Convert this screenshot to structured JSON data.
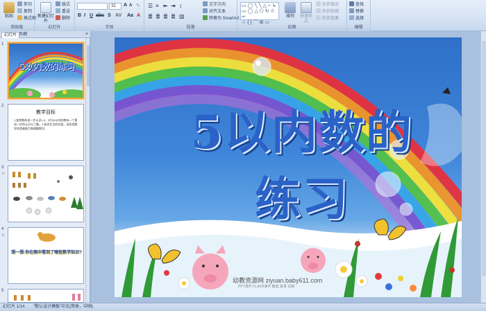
{
  "ribbon": {
    "groups": {
      "clipboard": "剪贴板",
      "slides": "幻灯片",
      "font": "字体",
      "paragraph": "段落",
      "drawing": "绘图",
      "editing": "编辑"
    },
    "paste": "粘贴",
    "cut": "剪切",
    "copy": "复制",
    "format_painter": "格式刷",
    "new_slide": "新建幻灯片",
    "layout": "版式",
    "reset": "重设",
    "delete": "删除",
    "font_size": "32",
    "text_direction": "文字方向",
    "align_text": "对齐文本",
    "smartart": "转换为 SmartArt",
    "arrange": "排列",
    "quick_styles": "快速样式",
    "shape_fill": "形状填充",
    "shape_outline": "形状轮廓",
    "shape_effects": "形状效果",
    "find": "查找",
    "replace": "替换",
    "select": "选择"
  },
  "pane": {
    "tab_slides": "幻灯片",
    "tab_outline": "大纲",
    "close": "×",
    "thumbs": [
      {
        "num": "1",
        "star": ""
      },
      {
        "num": "2",
        "star": ""
      },
      {
        "num": "3",
        "star": "☆"
      },
      {
        "num": "4",
        "star": "☆"
      },
      {
        "num": "5",
        "star": ""
      }
    ],
    "thumb1_title": "5以内数的练习",
    "thumb2_title": "教学目标",
    "thumb2_body": "1.使用数的进一步认识1-5，对与5以内的数有一个更进一步的认识与了解。2.结合生活的实践，培养用数学的思维能力和理解数学。",
    "thumb4_text": "想一想:你在图中看到了哪些数学知识?"
  },
  "slide": {
    "title": "5以内数的练习",
    "watermark": "幼教资源网 ziyuan.baby611.com",
    "watermark_sub": "PPT课件  FLASH课件  教案  故事  试卷"
  },
  "status": {
    "slide_count": "幻灯片 1/14",
    "theme": "\"默认设计模板\"",
    "language": "中文(简体，中国)"
  }
}
